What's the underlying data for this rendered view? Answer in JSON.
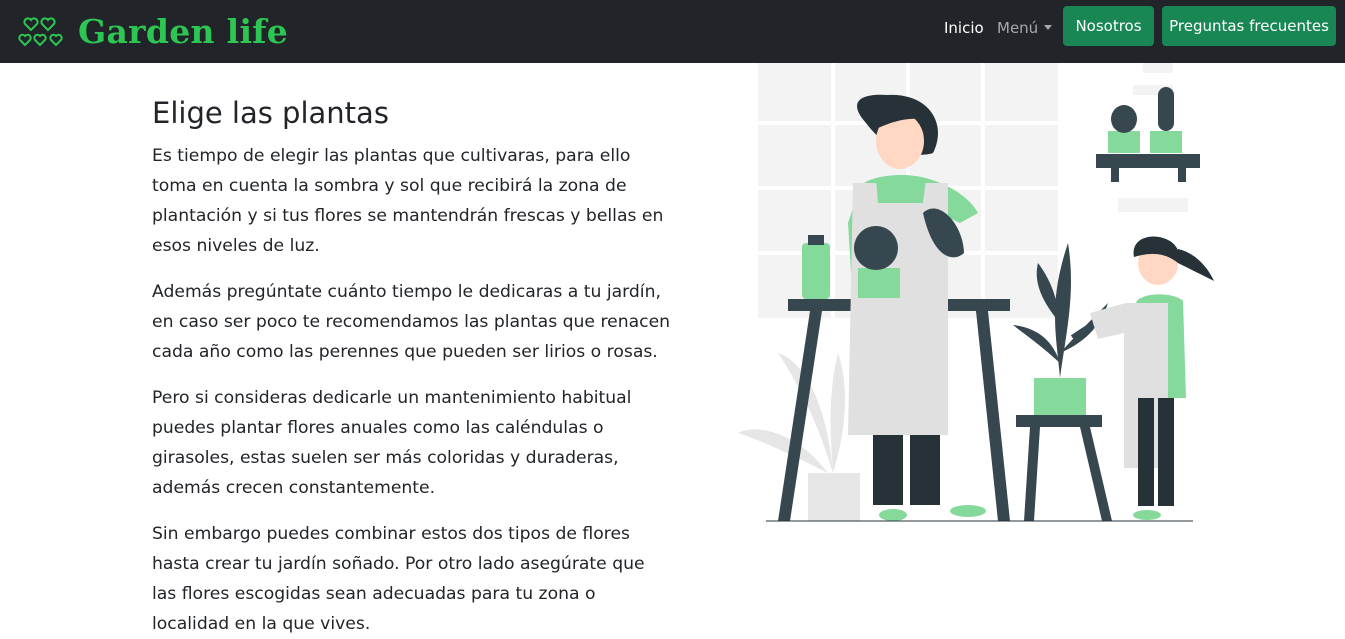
{
  "navbar": {
    "brand": "Garden life",
    "brand_icon": "hearts-icon",
    "links": {
      "home": "Inicio",
      "menu": "Menú"
    },
    "buttons": {
      "about": "Nosotros",
      "faq": "Preguntas frecuentes"
    }
  },
  "main": {
    "heading": "Elige las plantas",
    "paragraphs": [
      "Es tiempo de elegir las plantas que cultivaras, para ello toma en cuenta la sombra y sol que recibirá la zona de plantación y si tus flores se mantendrán frescas y bellas en esos niveles de luz.",
      "Además pregúntate cuánto tiempo le dedicaras a tu jardín, en caso ser poco te recomendamos las plantas que renacen cada año como las perennes que pueden ser lirios o rosas.",
      "Pero si consideras dedicarle un mantenimiento habitual puedes plantar flores anuales como las caléndulas o girasoles, estas suelen ser más coloridas y duraderas, además crecen constantemente.",
      "Sin embargo puedes combinar estos dos tipos de flores hasta crear tu jardín soñado. Por otro lado asegúrate que las flores escogidas sean adecuadas para tu zona o localidad en la que vives."
    ],
    "illustration": "woman-and-girl-gardening-illustration"
  },
  "colors": {
    "navbar": "#212529",
    "brand": "#2dc653",
    "button": "#198754",
    "accent_green": "#84d99b",
    "dark_slate": "#37474f"
  }
}
